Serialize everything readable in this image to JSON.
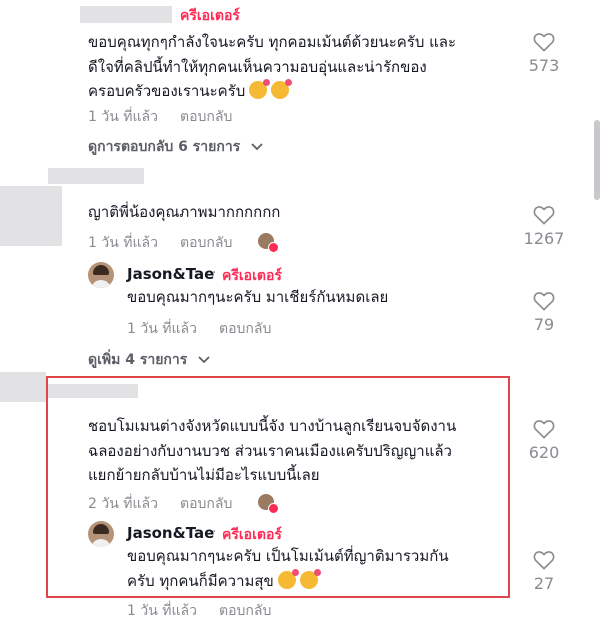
{
  "comments": [
    {
      "creator_label": "ครีเอเตอร์",
      "lines": [
        "ขอบคุณทุกๆกำลังใจนะครับ ทุกคอมเม้นต์ด้วยนะครับ และ",
        "ดีใจที่คลิปนี้ทำให้ทุกคนเห็นความอบอุ่นและน่ารักของ",
        "ครอบครัวของเรานะครับ"
      ],
      "time": "1 วัน ที่แล้ว",
      "reply_label": "ตอบกลับ",
      "likes": "573",
      "view_replies": "ดูการตอบกลับ 6 รายการ"
    },
    {
      "lines": [
        "ญาติพี่น้องคุณภาพมากกกกกก"
      ],
      "time": "1 วัน ที่แล้ว",
      "reply_label": "ตอบกลับ",
      "likes": "1267",
      "reply": {
        "author": "Jason&Tae",
        "creator_label": "ครีเอเตอร์",
        "lines": [
          "ขอบคุณมากๆนะครับ มาเชียร์กันหมดเลย"
        ],
        "time": "1 วัน ที่แล้ว",
        "reply_label": "ตอบกลับ",
        "likes": "79"
      },
      "view_more": "ดูเพิ่ม 4 รายการ"
    },
    {
      "lines": [
        "ชอบโมเมนต่างจังหวัดแบบนี้จัง บางบ้านลูกเรียนจบจัดงาน",
        "ฉลองอย่างกับงานบวช ส่วนเราคนเมืองแครับปริญญาแล้ว",
        "แยกย้ายกลับบ้านไม่มีอะไรแบบนี้เลย"
      ],
      "time": "2 วัน ที่แล้ว",
      "reply_label": "ตอบกลับ",
      "likes": "620",
      "reply": {
        "author": "Jason&Tae",
        "creator_label": "ครีเอเตอร์",
        "lines": [
          "ขอบคุณมากๆนะครับ เป็นโมเม้นต์ที่ญาติมารวมกัน",
          "ครับ ทุกคนก็มีความสุข"
        ],
        "time": "1 วัน ที่แล้ว",
        "reply_label": "ตอบกลับ",
        "likes": "27"
      }
    }
  ],
  "icons": {
    "like": "heart-outline-icon",
    "expand": "chevron-down-icon",
    "liked_by_creator": "creator-liked-avatar-icon",
    "emoji": "smiling-face-with-hearts-emoji"
  },
  "colors": {
    "creator_accent": "#fe2c55",
    "highlight_border": "#e0454c",
    "meta_text": "#8a8b91"
  }
}
